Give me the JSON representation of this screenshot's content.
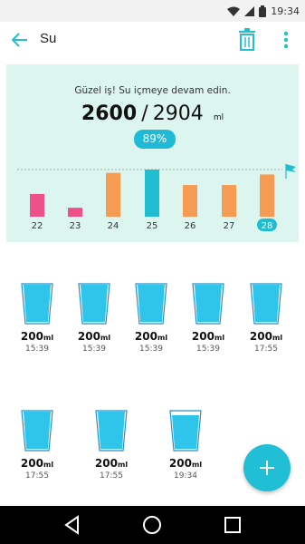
{
  "status": {
    "time": "19:34",
    "icons": [
      "wifi-icon",
      "signal-icon",
      "battery-icon"
    ]
  },
  "appbar": {
    "title": "Su",
    "icons": [
      "back-arrow-icon",
      "trash-icon",
      "more-vert-icon"
    ]
  },
  "summary": {
    "message": "Güzel iş! Su içmeye devam edin.",
    "current": "2600",
    "separator": "/",
    "goal": "2904",
    "unit": "ml",
    "percent": "89%"
  },
  "chart_data": {
    "type": "bar",
    "categories": [
      "22",
      "23",
      "24",
      "25",
      "26",
      "27",
      "28"
    ],
    "values": [
      1400,
      550,
      2700,
      2904,
      1950,
      1950,
      2600
    ],
    "colors": [
      "#f0508a",
      "#f0508a",
      "#f79a52",
      "#20bcd0",
      "#f79a52",
      "#f79a52",
      "#f79a52"
    ],
    "goal_line": 2904,
    "selected_day": "28",
    "ylim": [
      0,
      2904
    ]
  },
  "entries": [
    {
      "amount": "200",
      "unit": "ml",
      "time": "15:39"
    },
    {
      "amount": "200",
      "unit": "ml",
      "time": "15:39"
    },
    {
      "amount": "200",
      "unit": "ml",
      "time": "15:39"
    },
    {
      "amount": "200",
      "unit": "ml",
      "time": "15:39"
    },
    {
      "amount": "200",
      "unit": "ml",
      "time": "17:55"
    },
    {
      "amount": "200",
      "unit": "ml",
      "time": "17:55"
    },
    {
      "amount": "200",
      "unit": "ml",
      "time": "17:55"
    },
    {
      "amount": "200",
      "unit": "ml",
      "time": "19:34"
    }
  ],
  "fab": {
    "icon": "plus-icon"
  },
  "navbar": {
    "icons": [
      "nav-back-icon",
      "nav-home-icon",
      "nav-recents-icon"
    ]
  },
  "colors": {
    "accent": "#20bfd6",
    "card": "#dcf5ee",
    "pink": "#f0508a",
    "orange": "#f79a52",
    "teal": "#20bcd0"
  }
}
